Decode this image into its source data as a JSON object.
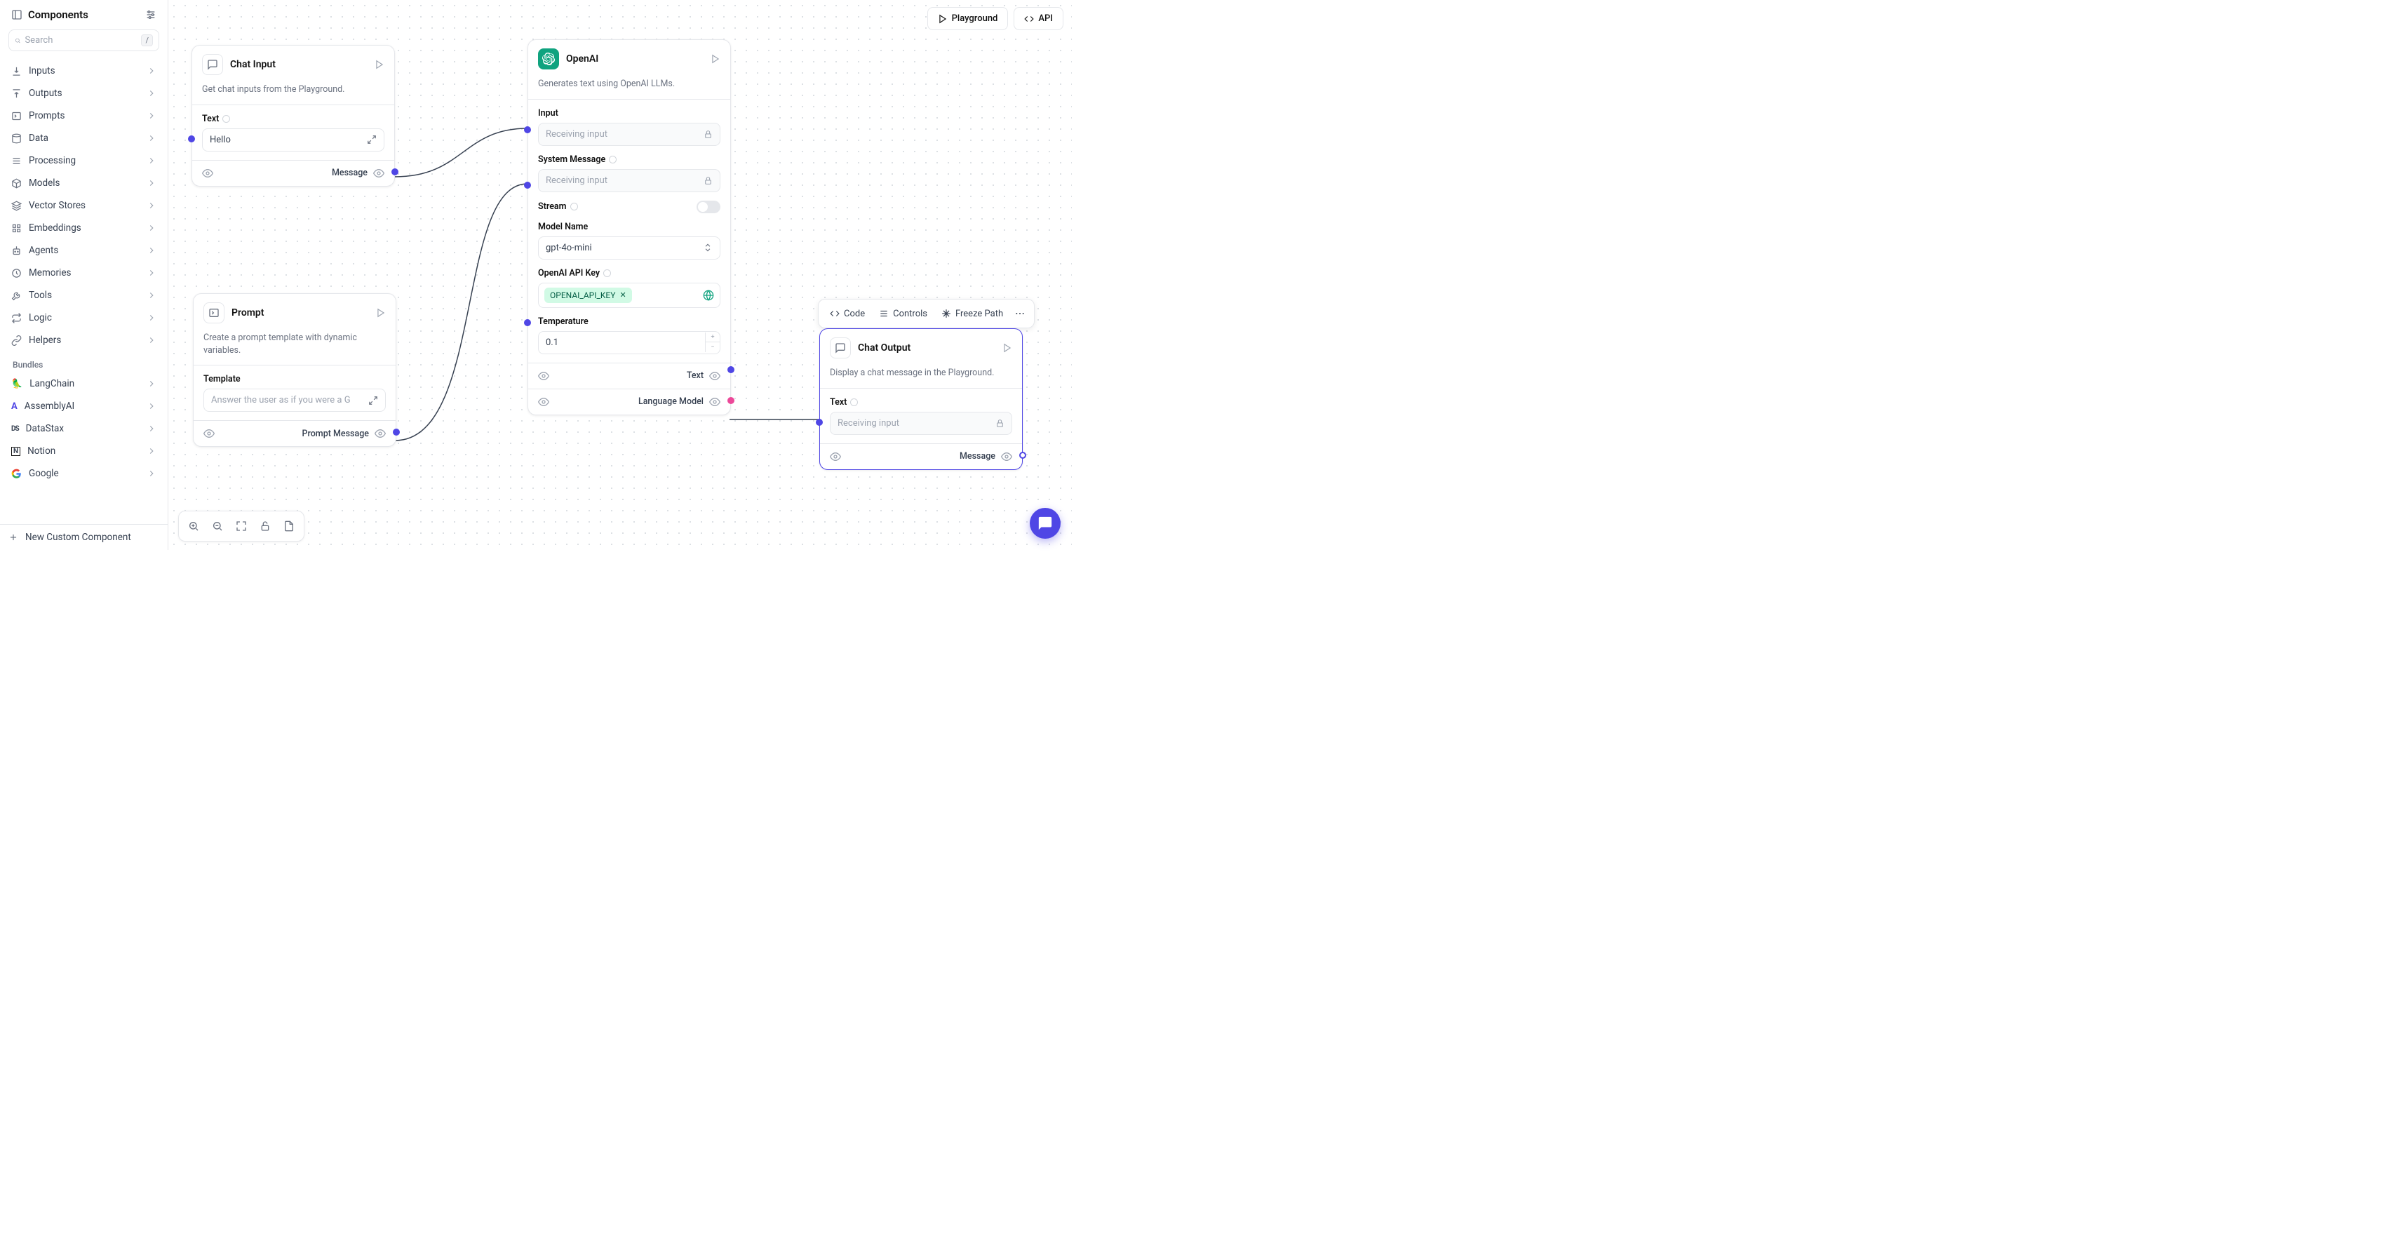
{
  "sidebar": {
    "title": "Components",
    "search_placeholder": "Search",
    "shortcut": "/",
    "categories": [
      {
        "label": "Inputs",
        "icon": "download"
      },
      {
        "label": "Outputs",
        "icon": "upload"
      },
      {
        "label": "Prompts",
        "icon": "terminal"
      },
      {
        "label": "Data",
        "icon": "database"
      },
      {
        "label": "Processing",
        "icon": "list"
      },
      {
        "label": "Models",
        "icon": "cube"
      },
      {
        "label": "Vector Stores",
        "icon": "layers"
      },
      {
        "label": "Embeddings",
        "icon": "binary"
      },
      {
        "label": "Agents",
        "icon": "robot"
      },
      {
        "label": "Memories",
        "icon": "clock"
      },
      {
        "label": "Tools",
        "icon": "wrench"
      },
      {
        "label": "Logic",
        "icon": "swap"
      },
      {
        "label": "Helpers",
        "icon": "link"
      }
    ],
    "bundles_label": "Bundles",
    "bundles": [
      {
        "label": "LangChain",
        "icon": "langchain"
      },
      {
        "label": "AssemblyAI",
        "icon": "assemblyai"
      },
      {
        "label": "DataStax",
        "icon": "datastax"
      },
      {
        "label": "Notion",
        "icon": "notion"
      },
      {
        "label": "Google",
        "icon": "google"
      }
    ],
    "new_component": "New Custom Component"
  },
  "topbar": {
    "playground": "Playground",
    "api": "API"
  },
  "context_bar": {
    "code": "Code",
    "controls": "Controls",
    "freeze": "Freeze Path"
  },
  "nodes": {
    "chat_input": {
      "title": "Chat Input",
      "desc": "Get chat inputs from the Playground.",
      "text_label": "Text",
      "text_value": "Hello",
      "output": "Message"
    },
    "prompt": {
      "title": "Prompt",
      "desc": "Create a prompt template with dynamic variables.",
      "template_label": "Template",
      "template_value": "Answer the user as if you were a G",
      "output": "Prompt Message"
    },
    "openai": {
      "title": "OpenAI",
      "desc": "Generates text using OpenAI LLMs.",
      "input_label": "Input",
      "receiving": "Receiving input",
      "sysmsg_label": "System Message",
      "stream_label": "Stream",
      "model_label": "Model Name",
      "model_value": "gpt-4o-mini",
      "apikey_label": "OpenAI API Key",
      "apikey_value": "OPENAI_API_KEY",
      "temp_label": "Temperature",
      "temp_value": "0.1",
      "out_text": "Text",
      "out_model": "Language Model"
    },
    "chat_output": {
      "title": "Chat Output",
      "desc": "Display a chat message in the Playground.",
      "text_label": "Text",
      "receiving": "Receiving input",
      "output": "Message"
    }
  }
}
